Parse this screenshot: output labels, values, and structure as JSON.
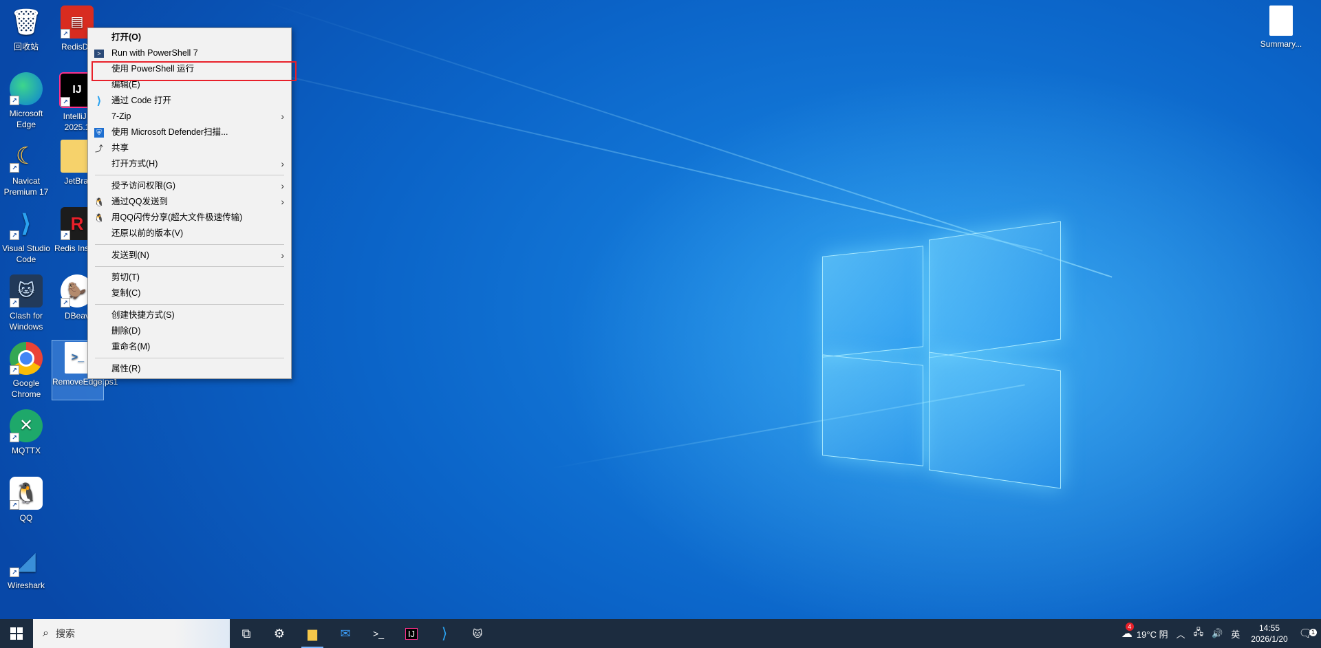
{
  "desktop": {
    "left_icons": [
      {
        "name": "recycle-bin",
        "label": "回收站"
      },
      {
        "name": "redis-desktop",
        "label": "RedisDe"
      },
      {
        "name": "microsoft-edge",
        "label": "Microsoft Edge"
      },
      {
        "name": "intellij",
        "label": "IntelliJ I 2025.1"
      },
      {
        "name": "navicat",
        "label": "Navicat Premium 17"
      },
      {
        "name": "jetbrains-folder",
        "label": "JetBrai"
      },
      {
        "name": "vscode",
        "label": "Visual Studio Code"
      },
      {
        "name": "redis-insight",
        "label": "Redis Insigh"
      },
      {
        "name": "clash",
        "label": "Clash for Windows"
      },
      {
        "name": "dbeaver",
        "label": "DBeav"
      },
      {
        "name": "chrome",
        "label": "Google Chrome"
      },
      {
        "name": "removeedge",
        "label": "RemoveEdge.ps1"
      },
      {
        "name": "mqttx",
        "label": "MQTTX"
      },
      {
        "name": "qq",
        "label": "QQ"
      },
      {
        "name": "wireshark",
        "label": "Wireshark"
      }
    ],
    "right_icon": {
      "label": "Summary..."
    }
  },
  "menu": {
    "items": [
      {
        "label": "打开(O)",
        "bold": true
      },
      {
        "label": "Run with PowerShell 7",
        "icon": "powershell-icon"
      },
      {
        "label": "使用 PowerShell 运行"
      },
      {
        "label": "编辑(E)"
      },
      {
        "label": "通过 Code 打开",
        "icon": "vscode-icon"
      },
      {
        "label": "7-Zip",
        "sub": true
      },
      {
        "label": "使用 Microsoft Defender扫描...",
        "icon": "defender-icon"
      },
      {
        "label": "共享",
        "icon": "share-icon"
      },
      {
        "label": "打开方式(H)",
        "sub": true
      },
      {
        "sep": true
      },
      {
        "label": "授予访问权限(G)",
        "sub": true
      },
      {
        "label": "通过QQ发送到",
        "icon": "qq-icon",
        "sub": true
      },
      {
        "label": "用QQ闪传分享(超大文件极速传输)",
        "icon": "qq-icon"
      },
      {
        "label": "还原以前的版本(V)"
      },
      {
        "sep": true
      },
      {
        "label": "发送到(N)",
        "sub": true
      },
      {
        "sep": true
      },
      {
        "label": "剪切(T)"
      },
      {
        "label": "复制(C)"
      },
      {
        "sep": true
      },
      {
        "label": "创建快捷方式(S)"
      },
      {
        "label": "删除(D)"
      },
      {
        "label": "重命名(M)"
      },
      {
        "sep": true
      },
      {
        "label": "属性(R)"
      }
    ]
  },
  "taskbar": {
    "search_placeholder": "搜索",
    "weather": "19°C 阴",
    "weather_badge": "4",
    "ime": "英",
    "time": "14:55",
    "date": "2026/1/20",
    "notifications": "1"
  },
  "colors": {
    "highlight": "#e8202a",
    "taskbar": "#1c2c3f"
  }
}
